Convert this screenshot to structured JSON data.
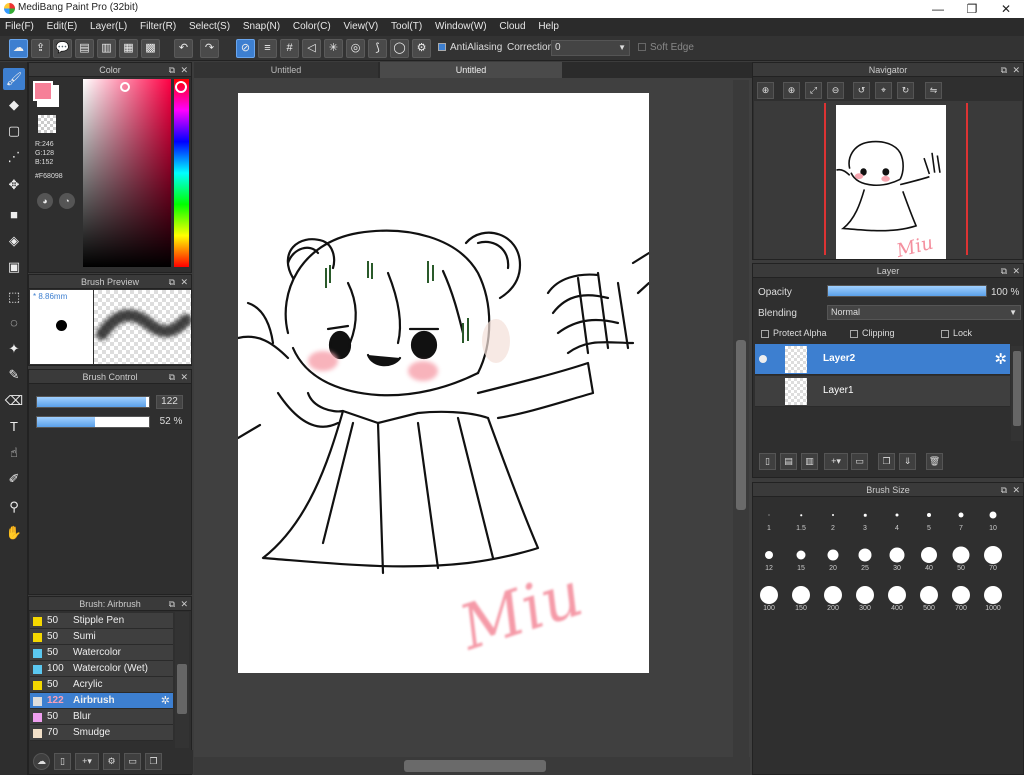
{
  "window": {
    "title": "MediBang Paint Pro (32bit)",
    "minimize": "—",
    "restore": "❐",
    "close": "✕"
  },
  "menu": [
    "File(F)",
    "Edit(E)",
    "Layer(L)",
    "Filter(R)",
    "Select(S)",
    "Snap(N)",
    "Color(C)",
    "View(V)",
    "Tool(T)",
    "Window(W)",
    "Cloud",
    "Help"
  ],
  "toolbar": {
    "antialiasing_label": "AntiAliasing",
    "correction_label": "Correction",
    "correction_value": "0",
    "soft_edge_label": "Soft Edge"
  },
  "color_panel": {
    "title": "Color",
    "r": "R:246",
    "g": "G:128",
    "b": "B:152",
    "hex": "#F68098",
    "fg_color": "#f68098"
  },
  "brush_preview": {
    "title": "Brush Preview",
    "size": "* 8.86mm"
  },
  "brush_control": {
    "title": "Brush Control",
    "size_value": "122",
    "opacity_value": "52 %",
    "size_fraction": 0.97,
    "opacity_fraction": 0.52
  },
  "brush_list": {
    "title": "Brush: Airbrush",
    "items": [
      {
        "size": "50",
        "name": "Stipple Pen",
        "color": "#f5d800"
      },
      {
        "size": "50",
        "name": "Sumi",
        "color": "#f5d800"
      },
      {
        "size": "50",
        "name": "Watercolor",
        "color": "#5bc8f0"
      },
      {
        "size": "100",
        "name": "Watercolor (Wet)",
        "color": "#5bc8f0"
      },
      {
        "size": "50",
        "name": "Acrylic",
        "color": "#f5d800"
      },
      {
        "size": "122",
        "name": "Airbrush",
        "color": "#dddddd"
      },
      {
        "size": "50",
        "name": "Blur",
        "color": "#f0a0f0"
      },
      {
        "size": "70",
        "name": "Smudge",
        "color": "#f2e0c8"
      }
    ]
  },
  "tabs": [
    "Untitled",
    "Untitled"
  ],
  "canvas": {
    "signature": "Miu"
  },
  "navigator": {
    "title": "Navigator"
  },
  "layer_panel": {
    "title": "Layer",
    "opacity_label": "Opacity",
    "opacity_value": "100 %",
    "blending_label": "Blending",
    "blending_value": "Normal",
    "protect_alpha": "Protect Alpha",
    "clipping": "Clipping",
    "lock": "Lock",
    "layers": [
      "Layer2",
      "Layer1"
    ]
  },
  "brush_size": {
    "title": "Brush Size",
    "sizes": [
      "1",
      "1.5",
      "2",
      "3",
      "4",
      "5",
      "7",
      "10",
      "12",
      "15",
      "20",
      "25",
      "30",
      "40",
      "50",
      "70",
      "100",
      "150",
      "200",
      "300",
      "400",
      "500",
      "700",
      "1000"
    ]
  }
}
